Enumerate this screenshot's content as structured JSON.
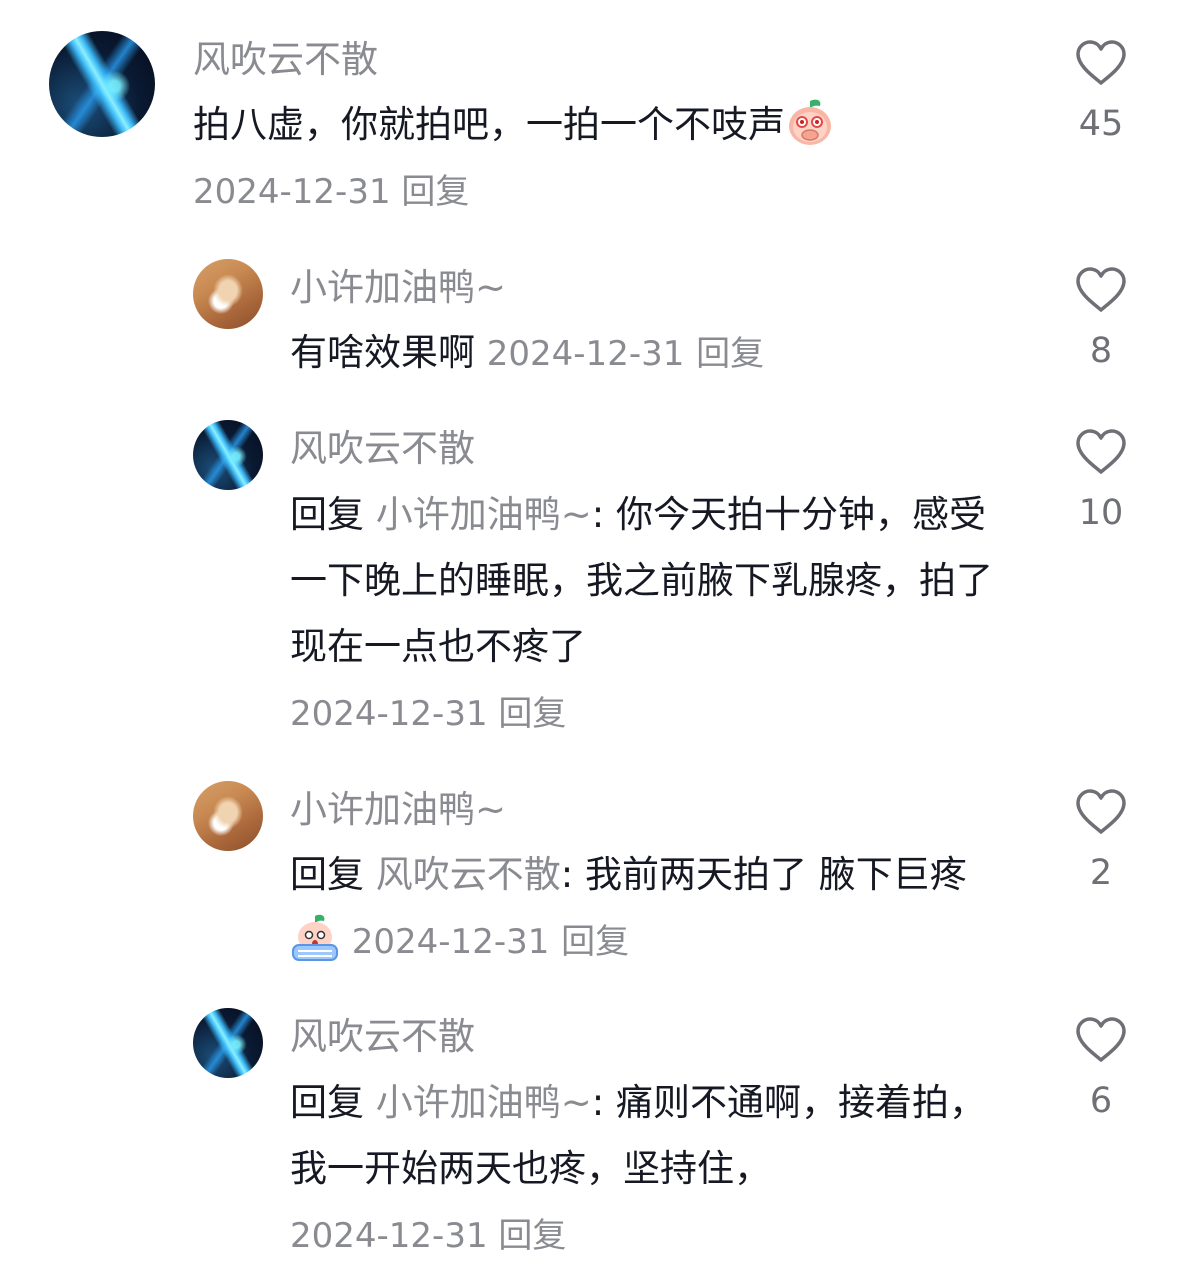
{
  "comments": [
    {
      "nickname": "风吹云不散",
      "content": "拍八虚，你就拍吧，一拍一个不吱声",
      "emoji": "peach-covering-mouth-emoji",
      "date": "2024-12-31",
      "reply_label": "回复",
      "likes": "45"
    },
    {
      "nickname": "小许加油鸭~",
      "content": "有啥效果啊",
      "date": "2024-12-31",
      "reply_label": "回复",
      "likes": "8"
    },
    {
      "nickname": "风吹云不散",
      "reply_prefix": "回复",
      "reply_target": "小许加油鸭~",
      "separator": ": ",
      "content": "你今天拍十分钟，感受一下晚上的睡眠，我之前腋下乳腺疼，拍了现在一点也不疼了",
      "date": "2024-12-31",
      "reply_label": "回复",
      "likes": "10"
    },
    {
      "nickname": "小许加油鸭~",
      "reply_prefix": "回复",
      "reply_target": "风吹云不散",
      "separator": ": ",
      "content": "我前两天拍了 腋下巨疼",
      "emoji": "peach-crying-bath-emoji",
      "date": "2024-12-31",
      "reply_label": "回复",
      "likes": "2"
    },
    {
      "nickname": "风吹云不散",
      "reply_prefix": "回复",
      "reply_target": "小许加油鸭~",
      "separator": ": ",
      "content": "痛则不通啊，接着拍，我一开始两天也疼，坚持住，",
      "date": "2024-12-31",
      "reply_label": "回复",
      "likes": "6"
    }
  ]
}
